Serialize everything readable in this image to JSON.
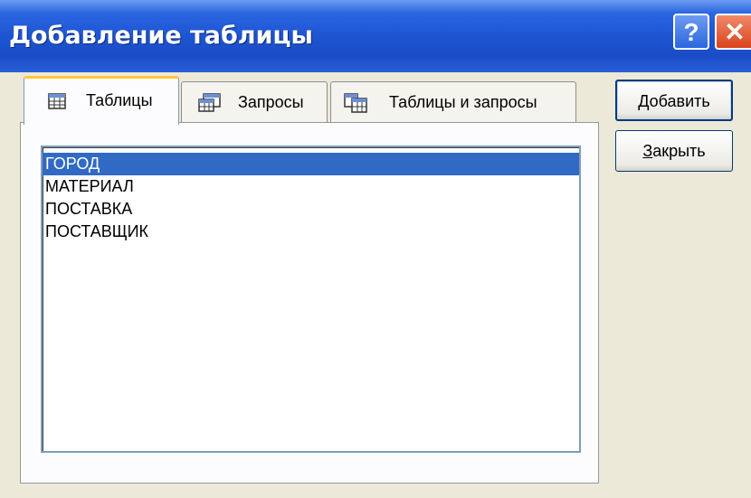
{
  "window": {
    "title": "Добавление таблицы"
  },
  "titlebar_buttons": {
    "help": "?",
    "close": "✕"
  },
  "tabs": [
    {
      "label": "Таблицы",
      "icon": "table-icon",
      "active": true
    },
    {
      "label": "Запросы",
      "icon": "query-icon",
      "active": false
    },
    {
      "label": "Таблицы и запросы",
      "icon": "tables-and-queries-icon",
      "active": false
    }
  ],
  "list": {
    "items": [
      "ГОРОД",
      "МАТЕРИАЛ",
      "ПОСТАВКА",
      "ПОСТАВЩИК"
    ],
    "selected": "ГОРОД"
  },
  "buttons": {
    "add": {
      "first": "Д",
      "rest": "обавить"
    },
    "close": {
      "first": "З",
      "rest": "акрыть"
    }
  },
  "colors": {
    "titlebar": "#1e54d2",
    "selection": "#316ac5",
    "active_tab_accent": "#ffc73c"
  }
}
